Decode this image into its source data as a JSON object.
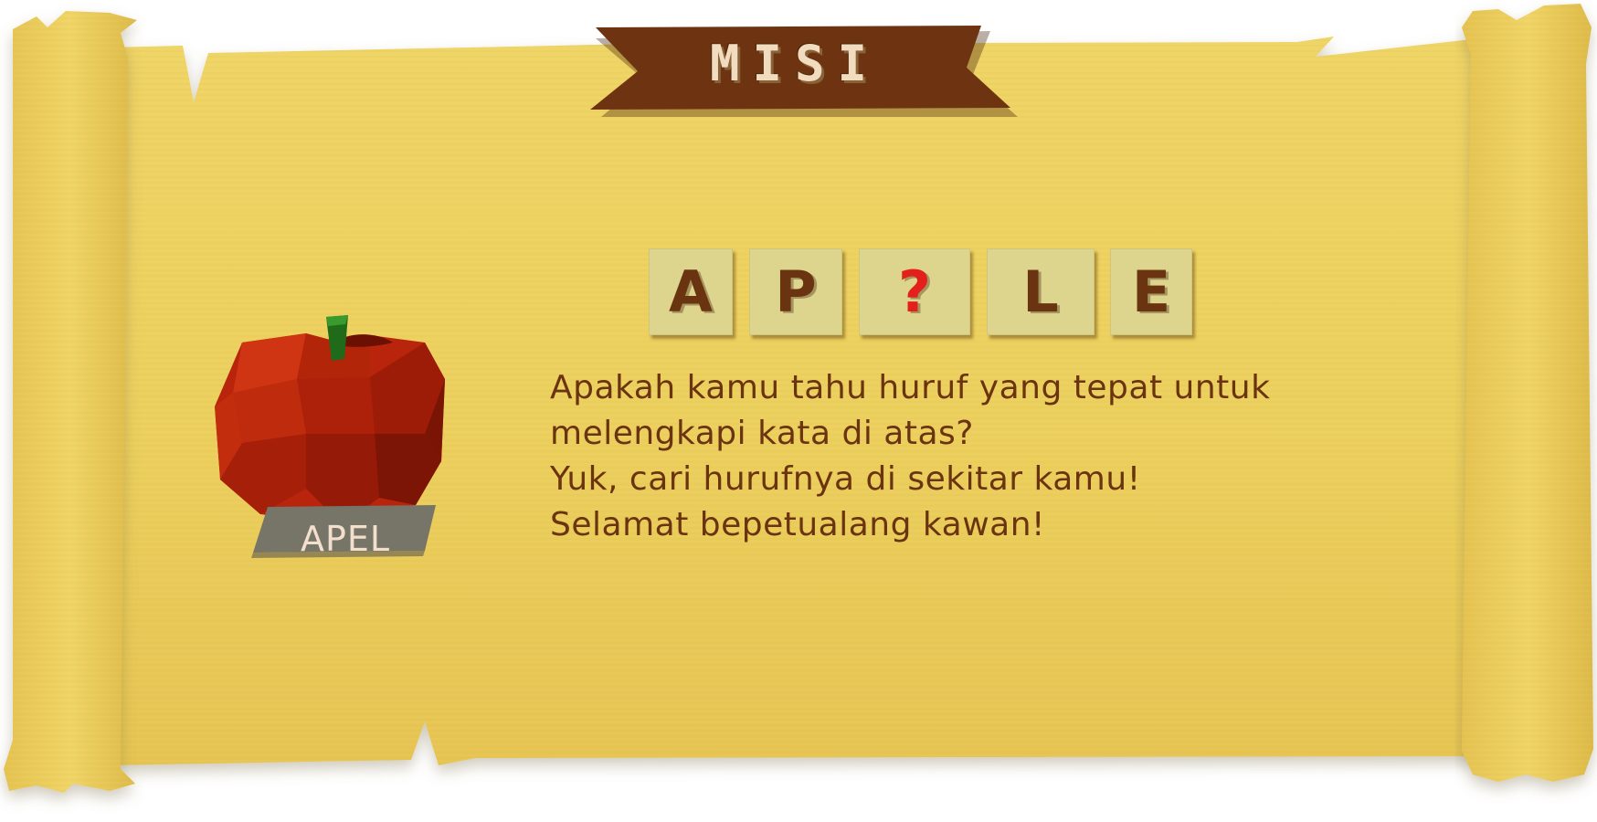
{
  "banner": {
    "title": "MISI"
  },
  "puzzle": {
    "tiles": [
      {
        "letter": "A",
        "missing": false
      },
      {
        "letter": "P",
        "missing": false
      },
      {
        "letter": "?",
        "missing": true
      },
      {
        "letter": "L",
        "missing": false
      },
      {
        "letter": "E",
        "missing": false
      }
    ]
  },
  "object": {
    "icon": "apple-icon",
    "label": "APEL"
  },
  "message": {
    "lines": [
      "Apakah kamu tahu huruf yang tepat untuk",
      "melengkapi kata di atas?",
      "Yuk, cari hurufnya di sekitar kamu!",
      "Selamat bepetualang kawan!"
    ]
  },
  "colors": {
    "parchment": "#eccf5d",
    "banner": "#6e3412",
    "text": "#6b3410",
    "tile": "#ddd58e",
    "missing_letter": "#e3201b",
    "apple": "#b8250c",
    "label_tag": "#777468"
  }
}
